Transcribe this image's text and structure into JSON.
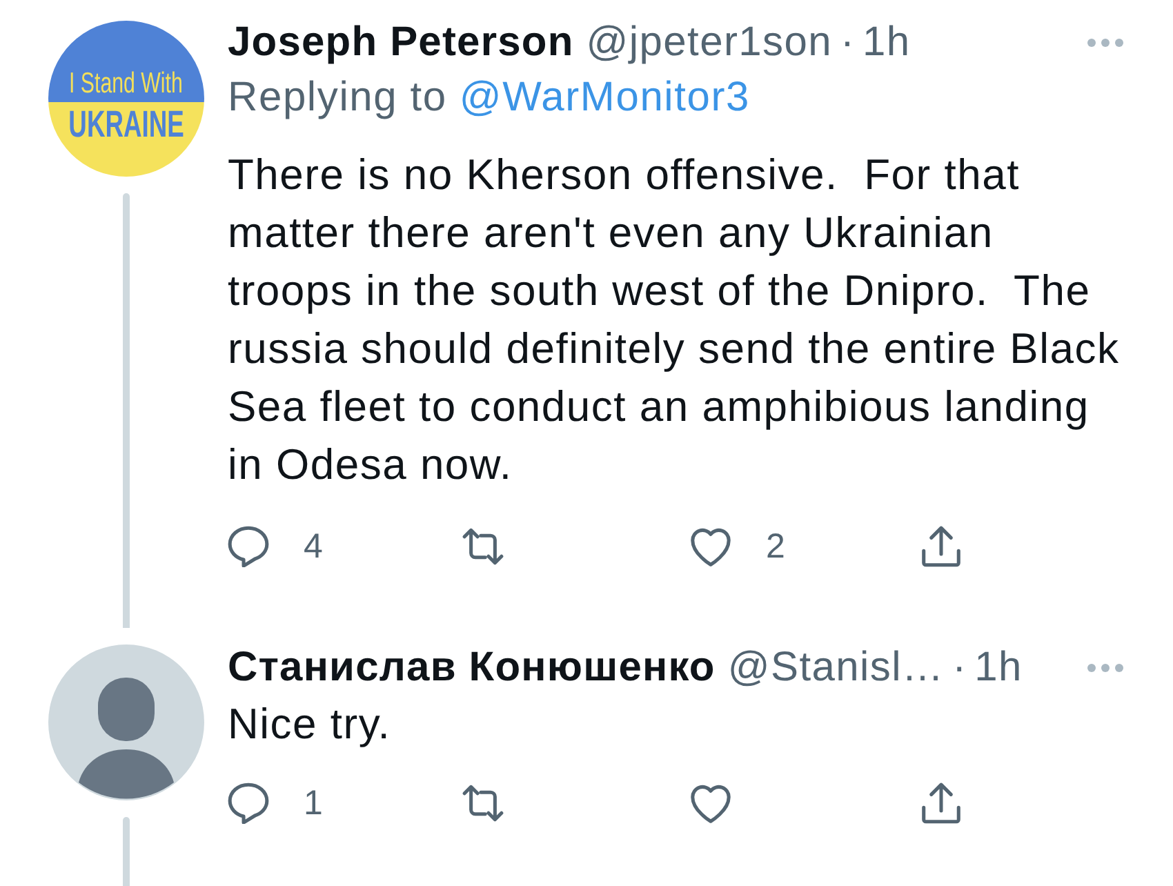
{
  "tweets": [
    {
      "author": {
        "name": "Joseph Peterson",
        "handle": "@jpeter1son",
        "separator": "·",
        "time": "1h"
      },
      "avatar": {
        "kind": "badge",
        "lines": [
          "I Stand With",
          "UKRAINE"
        ]
      },
      "threaded": true,
      "reply_to": {
        "label": "Replying to",
        "handle": "@WarMonitor3"
      },
      "body_lines": [
        "There is no Kherson offensive.  For that",
        "matter there aren't even any Ukrainian",
        "troops in the south west of the Dnipro.  The",
        "russia should definitely send the entire Black",
        "Sea fleet to conduct an amphibious landing",
        "in Odesa now."
      ],
      "actions": [
        {
          "kind": "reply",
          "count": "4"
        },
        {
          "kind": "retweet"
        },
        {
          "kind": "like",
          "count": "2"
        },
        {
          "kind": "share"
        }
      ]
    },
    {
      "author": {
        "name": "Станислав Конюшенко",
        "handle": "@Stanisl…",
        "separator": "·",
        "time": "1h"
      },
      "avatar": {
        "kind": "default"
      },
      "threaded": true,
      "body_lines": [
        "Nice try."
      ],
      "actions": [
        {
          "kind": "reply",
          "count": "1"
        },
        {
          "kind": "retweet"
        },
        {
          "kind": "like"
        },
        {
          "kind": "share"
        }
      ]
    }
  ]
}
